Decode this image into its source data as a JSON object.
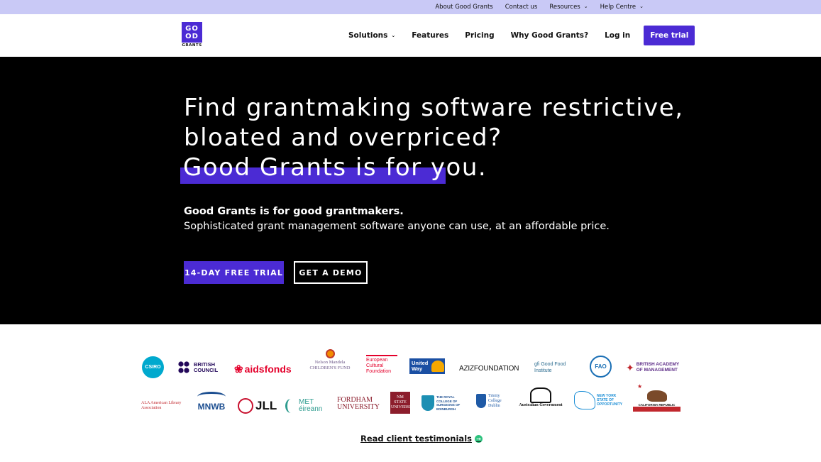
{
  "topbar": {
    "about": "About Good Grants",
    "contact": "Contact us",
    "resources": "Resources",
    "help": "Help Centre"
  },
  "header": {
    "logo_top": "GO",
    "logo_bottom": "OD",
    "logo_word": "GRANTS",
    "nav": {
      "solutions": "Solutions",
      "features": "Features",
      "pricing": "Pricing",
      "why": "Why Good Grants?",
      "login": "Log in",
      "trial": "Free trial"
    }
  },
  "hero": {
    "line1": "Find grantmaking software restrictive,",
    "line2": "bloated and overpriced?",
    "line3": "Good Grants is for you.",
    "sub1": "Good Grants is for good grantmakers.",
    "sub2": "Sophisticated grant management software anyone can use, at an affordable price.",
    "cta_primary": "14-DAY FREE TRIAL",
    "cta_secondary": "GET A DEMO"
  },
  "logos": {
    "csiro": "CSIRO",
    "british_council": "BRITISH COUNCIL",
    "aidsfonds": "aidsfonds",
    "mandela": "Nelson Mandela CHILDREN'S FUND",
    "ecf": "European Cultural Foundation",
    "united_way": "United Way",
    "aziz": "AZIZFOUNDATION",
    "gfi": "gfi Good Food Institute",
    "fao": "FAO",
    "bam": "BRITISH ACADEMY OF MANAGEMENT",
    "ala": "ALA American Library Association",
    "mnwb": "MNWB",
    "jll": "JLL",
    "met": "MET éireann",
    "fordham": "FORDHAM UNIVERSITY",
    "nmstate": "NM STATE UNIVERSITY",
    "rcse": "THE ROYAL COLLEGE OF SURGEONS OF EDINBURGH",
    "trinity": "Trinity College Dublin",
    "ausgov": "Australian Government",
    "newyork": "NEW YORK STATE OF OPPORTUNITY",
    "california": "CALIFORNIA REPUBLIC"
  },
  "testimonials_link": "Read client testimonials",
  "colors": {
    "brand_purple": "#4b2bd4",
    "topbar_bg": "#c9c9f6",
    "hero_bg": "#000000"
  }
}
